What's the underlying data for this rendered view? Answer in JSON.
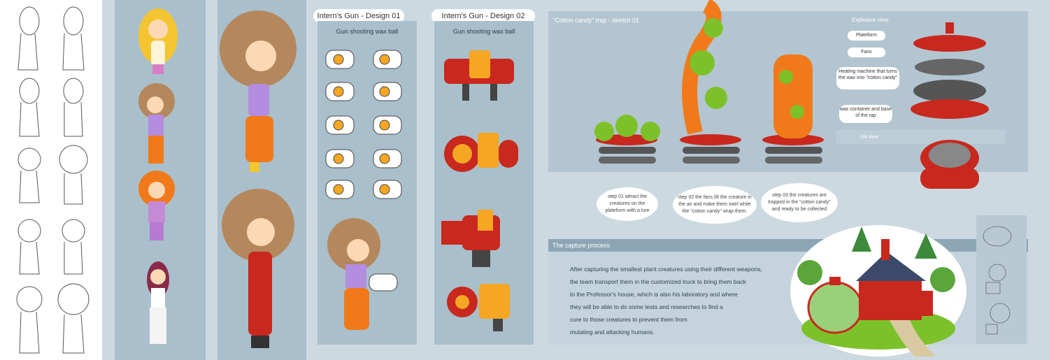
{
  "gun_design_01": {
    "title": "Intern's Gun - Design 01",
    "subtitle": "Gun shooting wax ball"
  },
  "gun_design_02": {
    "title": "Intern's Gun - Design 02",
    "subtitle": "Gun shooting wax ball"
  },
  "trap": {
    "title": "\"Cotton candy\" trap - sketch 01",
    "explosive_view": "Explosive view",
    "view_34": "3/4 view",
    "labels": {
      "plateform": "Plateform",
      "fans": "Fans",
      "heating": "Heating machine that turns the wax into \"cotton candy\"",
      "container": "wax container and base of the rap"
    },
    "steps": [
      "step 01 attract the creatures on the plateform with a lure",
      "step 02 the fans lift the creature in the air and make them swirl while the \"cotton candy\" wrap them.",
      "step 03 the creatures are trapped in the \"cotton candy\" and ready to be collected"
    ]
  },
  "capture": {
    "title": "The capture process",
    "lines": [
      "After capturing the smallest plant creatures using their different weapons,",
      "the team transport them in the  customized truck to bring them back",
      "to the Professor's house, which is also his laboratory and where",
      "they will be able to do some tests and researches to find a",
      "cure to those creatures to prevent them from",
      "mutating and attacking humans."
    ]
  },
  "colors": {
    "panel": "#a9bfcb",
    "red": "#c8281e",
    "orange": "#f07a1a",
    "yellow": "#f5c431",
    "hair_brown": "#b5875c"
  }
}
